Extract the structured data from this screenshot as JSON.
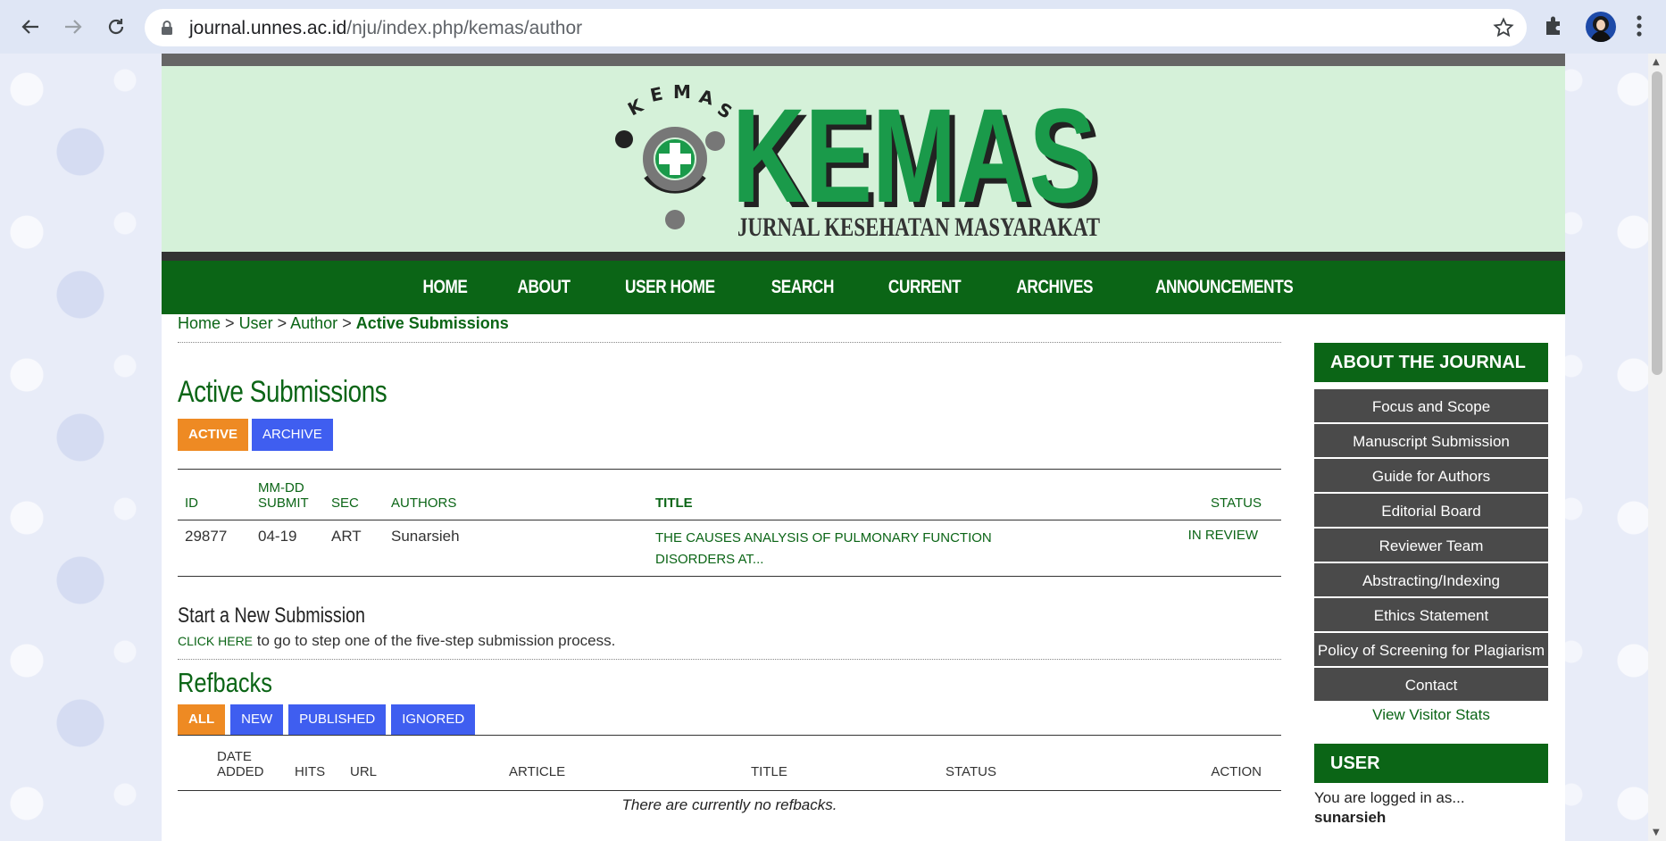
{
  "browser": {
    "url_host": "journal.unnes.ac.id",
    "url_path": "/nju/index.php/kemas/author"
  },
  "banner": {
    "logo_ring_text": "KEMAS",
    "logo_big": "KEMAS",
    "logo_sub": "JURNAL KESEHATAN MASYARAKAT"
  },
  "nav": [
    "HOME",
    "ABOUT",
    "USER HOME",
    "SEARCH",
    "CURRENT",
    "ARCHIVES",
    "ANNOUNCEMENTS"
  ],
  "breadcrumb": {
    "home": "Home",
    "user": "User",
    "author": "Author",
    "sep": ">",
    "current": "Active Submissions"
  },
  "page_title": "Active Submissions",
  "tabs": {
    "active": "ACTIVE",
    "archive": "ARCHIVE"
  },
  "submissions": {
    "headers": {
      "id": "ID",
      "date_top": "MM-DD",
      "date_bottom": "SUBMIT",
      "sec": "SEC",
      "authors": "AUTHORS",
      "title": "TITLE",
      "status": "STATUS"
    },
    "rows": [
      {
        "id": "29877",
        "date": "04-19",
        "sec": "ART",
        "authors": "Sunarsieh",
        "title_line1": "THE CAUSES ANALYSIS OF PULMONARY FUNCTION",
        "title_line2": "DISORDERS AT...",
        "status": "IN REVIEW"
      }
    ]
  },
  "new_submission": {
    "heading": "Start a New Submission",
    "link": "CLICK HERE",
    "text": " to go to step one of the five-step submission process."
  },
  "refbacks": {
    "heading": "Refbacks",
    "tabs": [
      "ALL",
      "NEW",
      "PUBLISHED",
      "IGNORED"
    ],
    "headers": {
      "date_top": "DATE",
      "date_bottom": "ADDED",
      "hits": "HITS",
      "url": "URL",
      "article": "ARTICLE",
      "title": "TITLE",
      "status": "STATUS",
      "action": "ACTION"
    },
    "empty": "There are currently no refbacks."
  },
  "sidebar": {
    "about_heading": "ABOUT THE JOURNAL",
    "menu": [
      "Focus and Scope",
      "Manuscript Submission",
      "Guide for Authors",
      "Editorial Board",
      "Reviewer Team",
      "Abstracting/Indexing",
      "Ethics Statement",
      "Policy of Screening for Plagiarism",
      "Contact"
    ],
    "visitor_stats": "View Visitor Stats",
    "user_heading": "USER",
    "logged_in": "You are logged in as...",
    "username": "sunarsieh"
  },
  "colors": {
    "brand_green": "#0b6516",
    "banner_bg": "#d5f1d9",
    "tab_active": "#ee8a23",
    "tab_inactive": "#3f5ef0",
    "sidebar_item": "#4a4a4a"
  },
  "icons": [
    "back-arrow-icon",
    "forward-arrow-icon",
    "reload-icon",
    "lock-icon",
    "star-icon",
    "extensions-icon",
    "profile-avatar",
    "menu-kebab-icon"
  ]
}
